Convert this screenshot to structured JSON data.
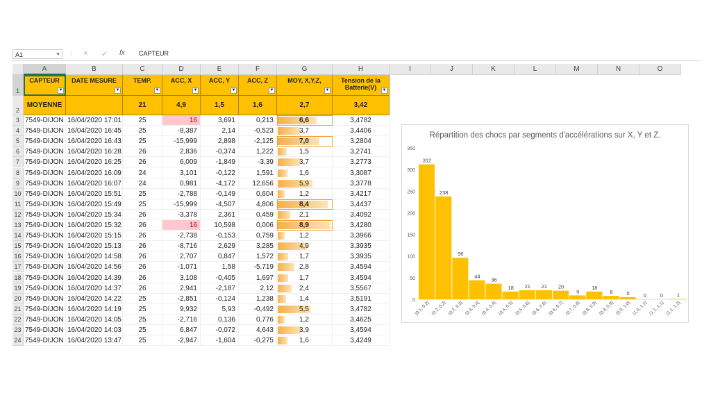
{
  "formula_bar": {
    "name_box": "A1",
    "cancel_icon": "×",
    "enter_icon": "✓",
    "fx_label": "fx",
    "content": "CAPTEUR"
  },
  "columns": [
    "A",
    "B",
    "C",
    "D",
    "E",
    "F",
    "G",
    "H",
    "I",
    "J",
    "K",
    "L",
    "M",
    "N",
    "O"
  ],
  "row_numbers": [
    "1",
    "2",
    "3",
    "4",
    "5",
    "6",
    "7",
    "8",
    "9",
    "10",
    "11",
    "12",
    "13",
    "14",
    "15",
    "16",
    "17",
    "18",
    "19",
    "20",
    "21",
    "22",
    "23",
    "24"
  ],
  "headers": [
    "CAPTEUR",
    "DATE MESURE",
    "TEMP.",
    "ACC, X",
    "ACC, Y",
    "ACC, Z",
    "MOY, X,Y,Z,",
    "Tension de la Batterie(V)"
  ],
  "moyenne": [
    "MOYENNE",
    "",
    "21",
    "4,9",
    "1,5",
    "1,6",
    "2,7",
    "3,42"
  ],
  "rows": [
    [
      "7549-DIJON",
      "16/04/2020 17:01",
      "25",
      "16",
      "3,691",
      "0,213",
      "6,6",
      "3,4782"
    ],
    [
      "7549-DIJON",
      "16/04/2020 16:45",
      "25",
      "-8,387",
      "2,14",
      "-0,523",
      "3,7",
      "3,4406"
    ],
    [
      "7549-DIJON",
      "16/04/2020 16:43",
      "25",
      "-15,999",
      "2,898",
      "-2,125",
      "7,0",
      "3,2804"
    ],
    [
      "7549-DIJON",
      "16/04/2020 16:28",
      "26",
      "2,836",
      "-0,374",
      "1,222",
      "1,5",
      "3,2741"
    ],
    [
      "7549-DIJON",
      "16/04/2020 16:25",
      "26",
      "6,009",
      "-1,849",
      "-3,39",
      "3,7",
      "3,2773"
    ],
    [
      "7549-DIJON",
      "16/04/2020 16:09",
      "24",
      "3,101",
      "-0,122",
      "1,591",
      "1,6",
      "3,3087"
    ],
    [
      "7549-DIJON",
      "16/04/2020 16:07",
      "24",
      "0,981",
      "-4,172",
      "12,656",
      "5,9",
      "3,3778"
    ],
    [
      "7549-DIJON",
      "16/04/2020 15:51",
      "25",
      "-2,788",
      "-0,149",
      "0,604",
      "1,2",
      "3,4217"
    ],
    [
      "7549-DIJON",
      "16/04/2020 15:49",
      "25",
      "-15,999",
      "-4,507",
      "4,806",
      "8,4",
      "3,4437"
    ],
    [
      "7549-DIJON",
      "16/04/2020 15:34",
      "26",
      "-3,378",
      "2,361",
      "0,459",
      "2,1",
      "3,4092"
    ],
    [
      "7549-DIJON",
      "16/04/2020 15:32",
      "26",
      "16",
      "10,598",
      "0,006",
      "8,9",
      "3,4280"
    ],
    [
      "7549-DIJON",
      "16/04/2020 15:15",
      "26",
      "-2,738",
      "-0,153",
      "0,759",
      "1,2",
      "3,3966"
    ],
    [
      "7549-DIJON",
      "16/04/2020 15:13",
      "26",
      "-8,716",
      "2,629",
      "3,285",
      "4,9",
      "3,3935"
    ],
    [
      "7549-DIJON",
      "16/04/2020 14:58",
      "26",
      "2,707",
      "0,847",
      "1,572",
      "1,7",
      "3,3935"
    ],
    [
      "7549-DIJON",
      "16/04/2020 14:56",
      "26",
      "-1,071",
      "1,58",
      "-5,719",
      "2,8",
      "3,4594"
    ],
    [
      "7549-DIJON",
      "16/04/2020 14:39",
      "26",
      "3,108",
      "-0,405",
      "1,697",
      "1,7",
      "3,4594"
    ],
    [
      "7549-DIJON",
      "16/04/2020 14:37",
      "26",
      "2,941",
      "-2,187",
      "2,12",
      "2,4",
      "3,5567"
    ],
    [
      "7549-DIJON",
      "16/04/2020 14:22",
      "25",
      "-2,851",
      "-0,124",
      "1,238",
      "1,4",
      "3,5191"
    ],
    [
      "7549-DIJON",
      "16/04/2020 14:19",
      "25",
      "9,932",
      "5,93",
      "-0,492",
      "5,5",
      "3,4782"
    ],
    [
      "7549-DIJON",
      "16/04/2020 14:05",
      "25",
      "-2,716",
      "0,136",
      "0,776",
      "1,2",
      "3,4625"
    ],
    [
      "7549-DIJON",
      "16/04/2020 14:03",
      "25",
      "6,847",
      "-0,072",
      "4,643",
      "3,9",
      "3,4594"
    ],
    [
      "7549-DIJON",
      "16/04/2020 13:47",
      "25",
      "-2,947",
      "-1,604",
      "-0,275",
      "1,6",
      "3,4249"
    ]
  ],
  "colors": {
    "header_fill": "#ffc000",
    "highlight_pink": "#ffc7ce",
    "bar": "#ffc000",
    "excel_green": "#217346"
  },
  "chart_data": {
    "type": "bar",
    "title": "Répartition des chocs par segments d'accélérations sur X, Y et Z.",
    "categories": [
      "[0,1, 0,2]",
      "(0,2, 0,2]",
      "(0,2, 0,3]",
      "(0,3, 0,4]",
      "(0,4, 0,4]",
      "(0,4, 0,5]",
      "(0,5, 0,6]",
      "(0,6, 0,6]",
      "(0,6, 0,7]",
      "(0,7, 0,8]",
      "(0,8, 0,9]",
      "(0,9, 0,9]",
      "(0,9, 1,0]",
      "(1,0, 1,1]",
      "(1,1, 1,1]",
      "(1,1, 1,2]"
    ],
    "values": [
      312,
      238,
      96,
      44,
      36,
      18,
      21,
      21,
      20,
      9,
      18,
      8,
      5,
      0,
      0,
      1
    ],
    "ylim": [
      0,
      350
    ],
    "yticks": [
      0,
      50,
      100,
      150,
      200,
      250,
      300,
      350
    ],
    "grid": false,
    "legend": "none"
  }
}
